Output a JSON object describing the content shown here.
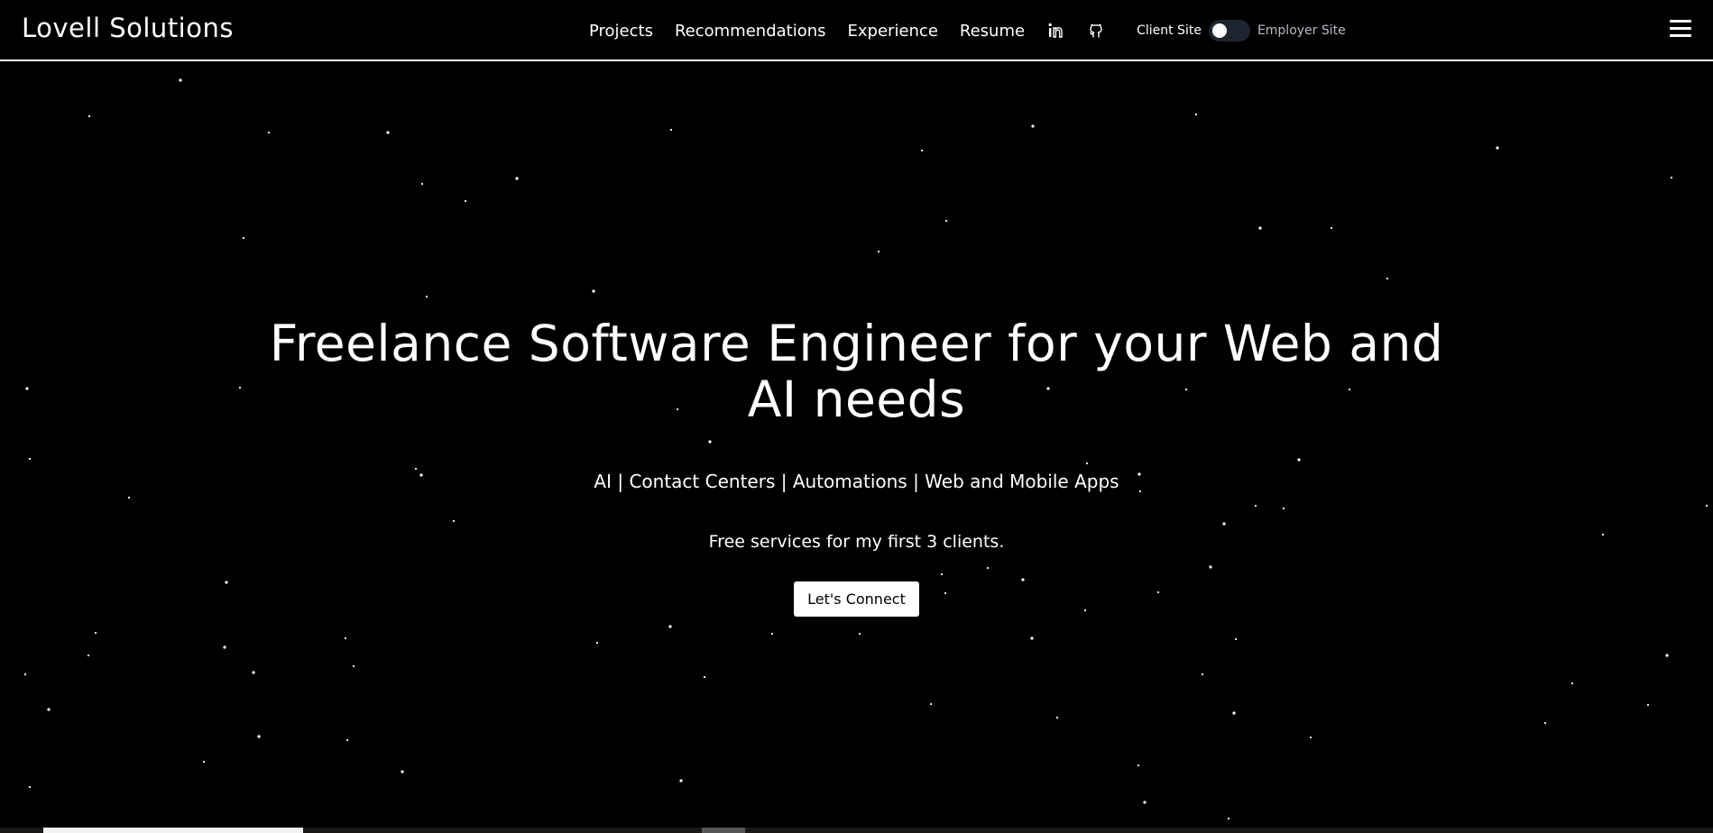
{
  "header": {
    "brand": "Lovell Solutions",
    "nav": {
      "projects": "Projects",
      "recommendations": "Recommendations",
      "experience": "Experience",
      "resume": "Resume"
    },
    "icons": [
      "linkedin-icon",
      "github-icon",
      "menu-icon"
    ],
    "toggle": {
      "left_label": "Client Site",
      "right_label": "Employer Site"
    }
  },
  "hero": {
    "title": "Freelance Software Engineer for your Web and AI needs",
    "subtitle": "AI | Contact Centers | Automations | Web and Mobile Apps",
    "note": "Free services for my first 3 clients.",
    "cta_label": "Let's Connect"
  },
  "colors": {
    "background": "#000000",
    "text": "#ffffff",
    "toggle_track": "#1f2530",
    "muted_text": "#b8bdc6"
  }
}
